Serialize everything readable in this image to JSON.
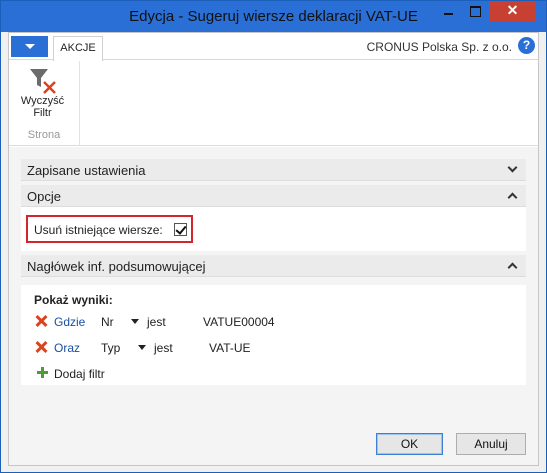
{
  "window": {
    "title": "Edycja - Sugeruj wiersze deklaracji VAT-UE",
    "close_glyph": "✕"
  },
  "ribbon": {
    "tab_label": "AKCJE",
    "company": "CRONUS Polska Sp. z o.o.",
    "help_glyph": "?",
    "clear_filter_line1": "Wyczyść",
    "clear_filter_line2": "Filtr",
    "group_label": "Strona"
  },
  "fasttabs": {
    "saved_settings": "Zapisane ustawienia",
    "options": "Opcje",
    "summary_header": "Nagłówek inf. podsumowującej"
  },
  "options": {
    "delete_existing_label": "Usuń istniejące wiersze:",
    "delete_existing_checked": true
  },
  "filters": {
    "title": "Pokaż wyniki:",
    "rows": [
      {
        "link": "Gdzie",
        "field": "Nr",
        "operator": "jest",
        "value": "VATUE00004"
      },
      {
        "link": "Oraz",
        "field": "Typ",
        "operator": "jest",
        "value": "VAT-UE"
      }
    ],
    "add_filter": "Dodaj filtr"
  },
  "buttons": {
    "ok": "OK",
    "cancel": "Anuluj"
  },
  "colors": {
    "accent": "#2a6fd6",
    "close": "#c74032",
    "highlight": "#d4252d",
    "link": "#1a4fa0"
  }
}
